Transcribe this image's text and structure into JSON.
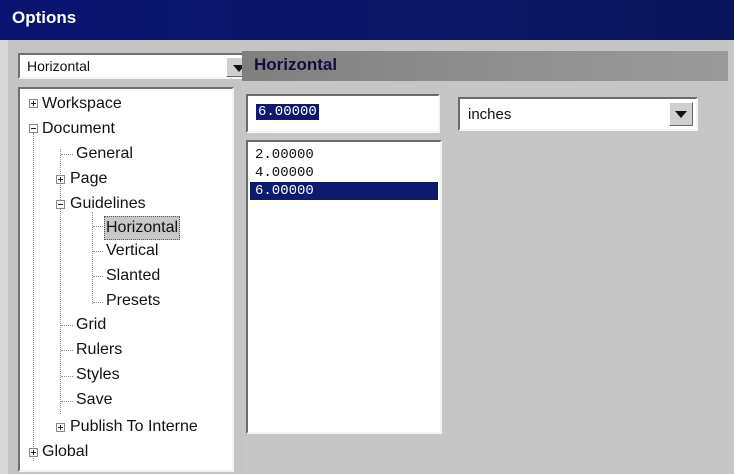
{
  "window": {
    "title": "Options"
  },
  "category_combo": {
    "value": "Horizontal"
  },
  "tree": {
    "workspace": "Workspace",
    "document": "Document",
    "general": "General",
    "page": "Page",
    "guidelines": "Guidelines",
    "horizontal": "Horizontal",
    "vertical": "Vertical",
    "slanted": "Slanted",
    "presets": "Presets",
    "grid": "Grid",
    "rulers": "Rulers",
    "styles": "Styles",
    "save": "Save",
    "publish": "Publish To Interne",
    "global": "Global"
  },
  "pane": {
    "title": "Horizontal",
    "value_input": "6.00000",
    "units": "inches",
    "guidelines": [
      "2.00000",
      "4.00000",
      "6.00000"
    ],
    "selected_guideline_index": 2
  },
  "colors": {
    "titlebar": "#0a1470",
    "selection": "#0e1a6e",
    "pane_header": "#8c8c8c"
  }
}
